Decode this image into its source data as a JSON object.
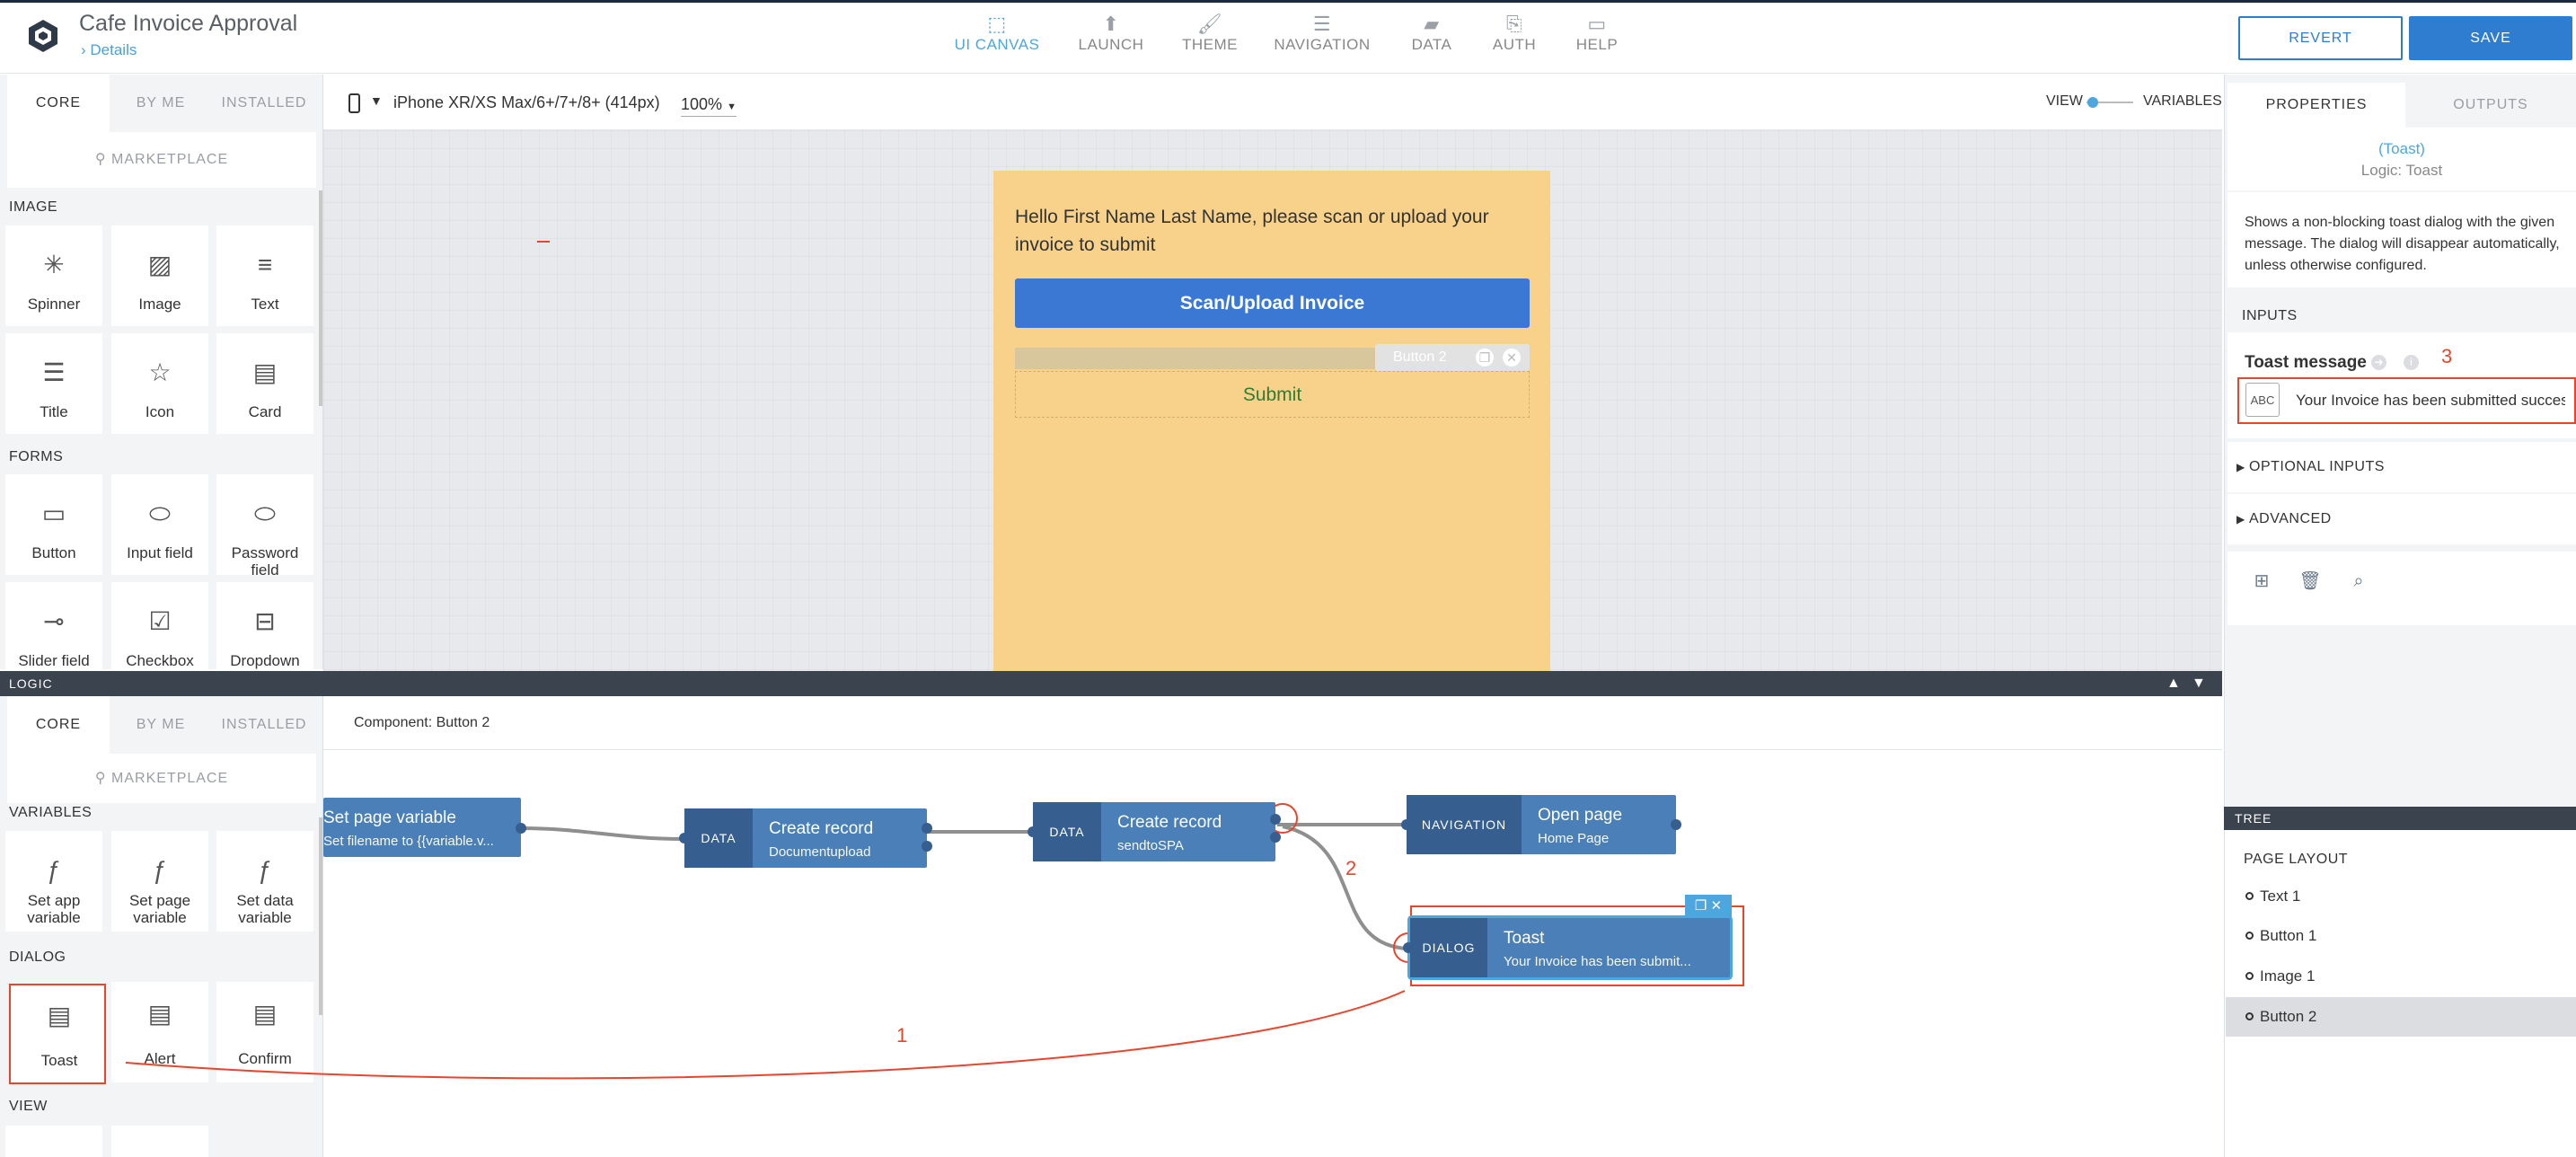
{
  "app": {
    "title": "Cafe Invoice Approval",
    "breadcrumb": "Details"
  },
  "topnav": [
    {
      "label": "UI CANVAS",
      "icon": "ui-canvas-icon",
      "glyph": "⬚",
      "active": true
    },
    {
      "label": "LAUNCH",
      "icon": "launch-icon",
      "glyph": "⬆"
    },
    {
      "label": "THEME",
      "icon": "theme-brush-icon",
      "glyph": "🖌"
    },
    {
      "label": "NAVIGATION",
      "icon": "navigation-list-icon",
      "glyph": "☰"
    },
    {
      "label": "DATA",
      "icon": "data-folder-icon",
      "glyph": "▰"
    },
    {
      "label": "AUTH",
      "icon": "auth-document-icon",
      "glyph": "⎘"
    },
    {
      "label": "HELP",
      "icon": "help-chat-icon",
      "glyph": "▭"
    }
  ],
  "actions": {
    "revert": "REVERT",
    "save": "SAVE"
  },
  "library_top": {
    "tabs": [
      "CORE",
      "BY ME",
      "INSTALLED"
    ],
    "marketplace": "MARKETPLACE",
    "sections": {
      "image": "IMAGE",
      "forms": "FORMS"
    },
    "tiles": [
      {
        "label": "Spinner",
        "icon": "spinner-icon",
        "glyph": "✳"
      },
      {
        "label": "Image",
        "icon": "image-icon",
        "glyph": "▨"
      },
      {
        "label": "Text",
        "icon": "text-icon",
        "glyph": "≡"
      },
      {
        "label": "Title",
        "icon": "title-icon",
        "glyph": "☰"
      },
      {
        "label": "Icon",
        "icon": "star-icon",
        "glyph": "☆"
      },
      {
        "label": "Card",
        "icon": "card-icon",
        "glyph": "▤"
      },
      {
        "label": "Button",
        "icon": "button-icon",
        "glyph": "▭"
      },
      {
        "label": "Input field",
        "icon": "input-field-icon",
        "glyph": "⬭"
      },
      {
        "label": "Password field",
        "icon": "password-field-icon",
        "glyph": "⬭"
      },
      {
        "label": "Slider field",
        "icon": "slider-icon",
        "glyph": "⊸"
      },
      {
        "label": "Checkbox field",
        "icon": "checkbox-icon",
        "glyph": "☑"
      },
      {
        "label": "Dropdown field",
        "icon": "dropdown-icon",
        "glyph": "⊟"
      }
    ]
  },
  "canvas": {
    "device": "iPhone XR/XS Max/6+/7+/8+ (414px)",
    "zoom": "100%",
    "view_label": "VIEW",
    "variables_label": "VARIABLES",
    "greeting": "Hello First Name Last Name, please scan or upload your invoice to submit",
    "scan_button": "Scan/Upload Invoice",
    "button2_tag": "Button 2",
    "submit_button": "Submit",
    "phone_color": "#f8d28b",
    "accent": "#3a78d4"
  },
  "logic": {
    "bar_label": "LOGIC",
    "component_label": "Component: Button 2",
    "library": {
      "tabs": [
        "CORE",
        "BY ME",
        "INSTALLED"
      ],
      "marketplace": "MARKETPLACE",
      "sections": {
        "variables": "VARIABLES",
        "dialog": "DIALOG",
        "view": "VIEW"
      },
      "tiles": [
        {
          "label": "Set app variable",
          "icon": "set-app-variable-icon",
          "glyph": "ƒ"
        },
        {
          "label": "Set page variable",
          "icon": "set-page-variable-icon",
          "glyph": "ƒ"
        },
        {
          "label": "Set data variable",
          "icon": "set-data-variable-icon",
          "glyph": "ƒ"
        },
        {
          "label": "Toast",
          "icon": "toast-icon",
          "glyph": "▤"
        },
        {
          "label": "Alert",
          "icon": "alert-icon",
          "glyph": "▤"
        },
        {
          "label": "Confirm",
          "icon": "confirm-icon",
          "glyph": "▤"
        }
      ]
    },
    "nodes": [
      {
        "type": "",
        "title": "Set page variable",
        "sub": "Set filename to {{variable.v..."
      },
      {
        "type": "DATA",
        "title": "Create record",
        "sub": "Documentupload"
      },
      {
        "type": "DATA",
        "title": "Create record",
        "sub": "sendtoSPA"
      },
      {
        "type": "NAVIGATION",
        "title": "Open page",
        "sub": "Home Page"
      },
      {
        "type": "DIALOG",
        "title": "Toast",
        "sub": "Your Invoice has been submit..."
      }
    ],
    "annotations": {
      "one": "1",
      "two": "2"
    },
    "annotation_color": "#e8452c"
  },
  "properties": {
    "tabs": [
      "PROPERTIES",
      "OUTPUTS"
    ],
    "component_name": "(Toast)",
    "component_logic": "Logic: Toast",
    "description": "Shows a non-blocking toast dialog with the given message. The dialog will disappear automatically, unless otherwise configured.",
    "inputs_label": "INPUTS",
    "toast_message_label": "Toast message",
    "annotation_three": "3",
    "abc_icon": "ABC",
    "toast_message_value": "Your Invoice has been submitted successfully",
    "optional_inputs": "OPTIONAL INPUTS",
    "advanced": "ADVANCED"
  },
  "tree": {
    "bar_label": "TREE",
    "page_layout": "PAGE LAYOUT",
    "items": [
      "Text 1",
      "Button 1",
      "Image 1",
      "Button 2"
    ],
    "selected": "Button 2"
  }
}
